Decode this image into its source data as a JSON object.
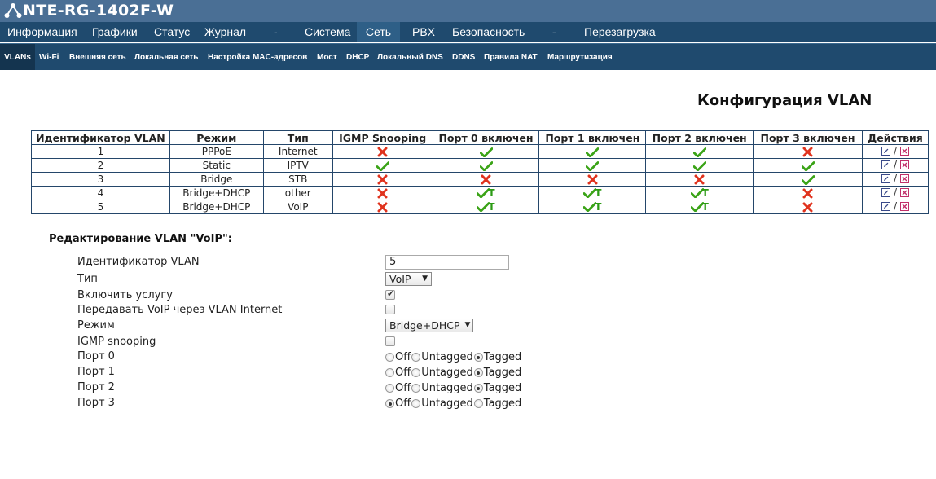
{
  "header": {
    "title": "NTE-RG-1402F-W"
  },
  "main_menu": [
    {
      "label": "Информация",
      "active": false,
      "separator": false
    },
    {
      "label": "Графики",
      "active": false,
      "separator": false
    },
    {
      "label": "Статус",
      "active": false,
      "separator": false
    },
    {
      "label": "Журнал",
      "active": false,
      "separator": false
    },
    {
      "label": "-",
      "active": false,
      "separator": true
    },
    {
      "label": "Система",
      "active": false,
      "separator": false
    },
    {
      "label": "Сеть",
      "active": true,
      "separator": false
    },
    {
      "label": "PBX",
      "active": false,
      "separator": false
    },
    {
      "label": "Безопасность",
      "active": false,
      "separator": false
    },
    {
      "label": "-",
      "active": false,
      "separator": true
    },
    {
      "label": "Перезагрузка",
      "active": false,
      "separator": false
    }
  ],
  "sub_menu": [
    {
      "label": "VLANs",
      "active": true
    },
    {
      "label": "Wi-Fi",
      "active": false
    },
    {
      "label": "Внешняя сеть",
      "active": false
    },
    {
      "label": "Локальная сеть",
      "active": false
    },
    {
      "label": "Настройка MAC-адресов",
      "active": false
    },
    {
      "label": "Мост",
      "active": false
    },
    {
      "label": "DHCP",
      "active": false
    },
    {
      "label": "Локальный DNS",
      "active": false
    },
    {
      "label": "DDNS",
      "active": false
    },
    {
      "label": "Правила NAT",
      "active": false
    },
    {
      "label": "Маршрутизация",
      "active": false
    }
  ],
  "page_title": "Конфигурация VLAN",
  "table": {
    "headers": [
      "Идентификатор VLAN",
      "Режим",
      "Тип",
      "IGMP Snooping",
      "Порт 0 включен",
      "Порт 1 включен",
      "Порт 2 включен",
      "Порт 3 включен",
      "Действия"
    ],
    "rows": [
      {
        "id": "1",
        "mode": "PPPoE",
        "type": "Internet",
        "igmp": "no",
        "ports": [
          "yes",
          "yes",
          "yes",
          "no"
        ]
      },
      {
        "id": "2",
        "mode": "Static",
        "type": "IPTV",
        "igmp": "yes",
        "ports": [
          "yes",
          "yes",
          "yes",
          "yes"
        ]
      },
      {
        "id": "3",
        "mode": "Bridge",
        "type": "STB",
        "igmp": "no",
        "ports": [
          "no",
          "no",
          "no",
          "yes"
        ]
      },
      {
        "id": "4",
        "mode": "Bridge+DHCP",
        "type": "other",
        "igmp": "no",
        "ports": [
          "tagged",
          "tagged",
          "tagged",
          "no"
        ]
      },
      {
        "id": "5",
        "mode": "Bridge+DHCP",
        "type": "VoIP",
        "igmp": "no",
        "ports": [
          "tagged",
          "tagged",
          "tagged",
          "no"
        ]
      }
    ],
    "tagged_letter": "T",
    "action_separator": "/",
    "icons": {
      "yes": "check-icon",
      "no": "cross-icon",
      "edit": "edit-icon",
      "delete": "delete-icon"
    },
    "colors": {
      "yes": "#3aa316",
      "no": "#e0331e",
      "border": "#24466a"
    }
  },
  "edit": {
    "title": "Редактирование VLAN \"VoIP\":",
    "vlan_id_label": "Идентификатор VLAN",
    "vlan_id_value": "5",
    "type_label": "Тип",
    "type_value": "VoIP",
    "enable_label": "Включить услугу",
    "enable_checked": true,
    "voip_via_internet_label": "Передавать VoIP через VLAN Internet",
    "voip_via_internet_checked": false,
    "mode_label": "Режим",
    "mode_value": "Bridge+DHCP",
    "igmp_label": "IGMP snooping",
    "igmp_checked": false,
    "radio_options": [
      "Off",
      "Untagged",
      "Tagged"
    ],
    "ports": [
      {
        "label": "Порт 0",
        "selected": "Tagged"
      },
      {
        "label": "Порт 1",
        "selected": "Tagged"
      },
      {
        "label": "Порт 2",
        "selected": "Tagged"
      },
      {
        "label": "Порт 3",
        "selected": "Off"
      }
    ]
  },
  "colors": {
    "header_bg": "#4a6f95",
    "menu_bg": "#1f4a6e",
    "active_tab": "#2e5f87"
  }
}
